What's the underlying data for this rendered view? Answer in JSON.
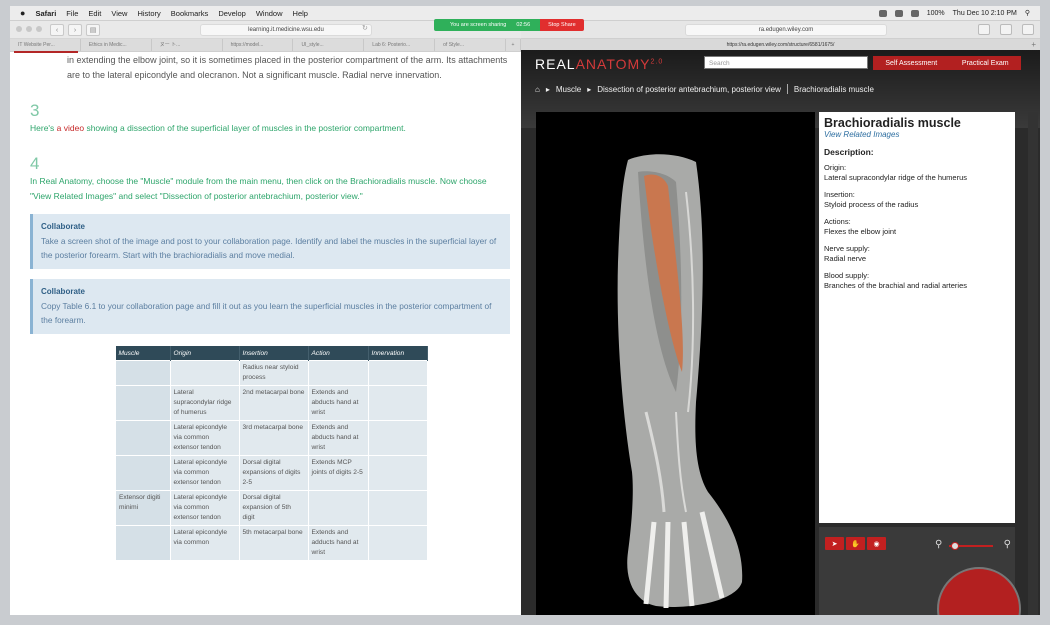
{
  "menubar": {
    "app": "Safari",
    "items": [
      "File",
      "Edit",
      "View",
      "History",
      "Bookmarks",
      "Develop",
      "Window",
      "Help"
    ],
    "battery": "100%",
    "datetime": "Thu Dec 10  2:10 PM"
  },
  "share_banner": {
    "text": "You are screen sharing",
    "time": "02:56",
    "stop_label": "Stop Share"
  },
  "left": {
    "url": "learning.it.medicine.wsu.edu",
    "tabs": [
      "IT Website Per...",
      "Ethics in Medic...",
      "ヌー ト...",
      "https://model...",
      "UI_style...",
      "Lab 6: Posterio...",
      "of Style..."
    ],
    "intro": "in extending the elbow joint, so it is sometimes placed in the posterior compartment of the arm. Its attachments are to the lateral epicondyle and olecranon. Not a significant muscle. Radial nerve innervation.",
    "step3_num": "3",
    "step3_pre": "Here's ",
    "step3_link": "a video",
    "step3_post": " showing a dissection of the superficial layer of muscles in the posterior compartment.",
    "step4_num": "4",
    "step4_text": "In Real Anatomy, choose the \"Muscle\" module from the main menu, then click on the Brachioradialis muscle. Now choose \"View Related Images\" and select \"Dissection of posterior antebrachium, posterior view.\"",
    "collab1_title": "Collaborate",
    "collab1_text": "Take a screen shot of the image and post to your collaboration page. Identify and label the muscles in the superficial layer of the posterior forearm. Start with the brachioradialis and move medial.",
    "collab2_title": "Collaborate",
    "collab2_text": "Copy Table 6.1 to your collaboration page and fill it out as you learn the superficial muscles in the posterior compartment of the forearm.",
    "table": {
      "headers": [
        "Muscle",
        "Origin",
        "Insertion",
        "Action",
        "Innervation"
      ],
      "rows": [
        [
          "",
          "",
          "Radius near styloid process",
          "",
          ""
        ],
        [
          "",
          "Lateral supracondylar ridge of humerus",
          "2nd metacarpal bone",
          "Extends and abducts hand at wrist",
          ""
        ],
        [
          "",
          "Lateral epicondyle via common extensor tendon",
          "3rd metacarpal bone",
          "Extends and abducts hand at wrist",
          ""
        ],
        [
          "",
          "Lateral epicondyle via common extensor tendon",
          "Dorsal digital expansions of digits 2-5",
          "Extends MCP joints of digits 2-5",
          ""
        ],
        [
          "Extensor digiti minimi",
          "Lateral epicondyle via common extensor tendon",
          "Dorsal digital expansion of 5th digit",
          "",
          ""
        ],
        [
          "",
          "Lateral epicondyle via common",
          "5th metacarpal bone",
          "Extends and adducts hand at wrist",
          ""
        ]
      ]
    }
  },
  "right": {
    "url": "ra.edugen.wiley.com",
    "tab": "https://ra.edugen.wiley.com/structure/6581/1675/",
    "logo_a": "REAL",
    "logo_b": "ANATOMY",
    "logo_sup": "2.0",
    "search_placeholder": "Search",
    "btn_self": "Self Assessment",
    "btn_exam": "Practical Exam",
    "crumbs": [
      "Muscle",
      "Dissection of posterior antebrachium, posterior view",
      "Brachioradialis muscle"
    ],
    "info": {
      "title": "Brachioradialis muscle",
      "related": "View Related Images",
      "desc_label": "Description:",
      "sections": [
        {
          "label": "Origin:",
          "value": "Lateral supracondylar ridge of the humerus"
        },
        {
          "label": "Insertion:",
          "value": "Styloid process of the radius"
        },
        {
          "label": "Actions:",
          "value": "Flexes the elbow joint"
        },
        {
          "label": "Nerve supply:",
          "value": "Radial nerve"
        },
        {
          "label": "Blood supply:",
          "value": "Branches of the brachial and radial arteries"
        }
      ]
    }
  }
}
